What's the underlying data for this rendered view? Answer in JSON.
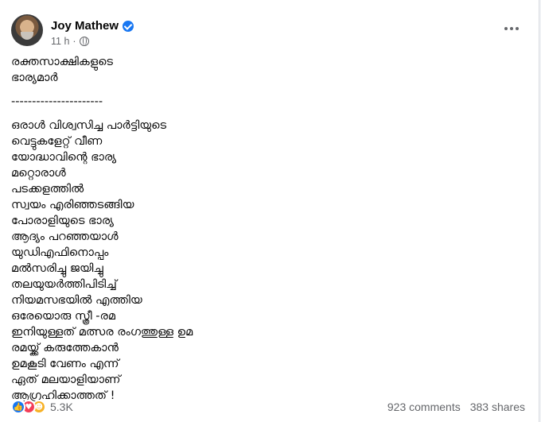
{
  "post": {
    "author": "Joy Mathew",
    "time": "11 h",
    "separator": "·",
    "lines": [
      "രക്തസാക്ഷികളുടെ",
      "ഭാര്യമാർ",
      "----------------------",
      "ഒരാൾ വിശ്വസിച്ച പാർട്ടിയുടെ",
      "വെട്ടുകളേറ്റ് വീണ",
      "യോദ്ധാവിന്റെ ഭാര്യ",
      "മറ്റൊരാൾ",
      "പടക്കളത്തിൽ",
      "സ്വയം എരിഞ്ഞടങ്ങിയ",
      "പോരാളിയുടെ ഭാര്യ",
      "ആദ്യം പറഞ്ഞയാൾ",
      "യുഡിഎഫിനൊപ്പം",
      "മൽസരിച്ചു ജയിച്ചു",
      "തലയുയർത്തിപിടിച്ച്",
      "നിയമസഭയിൽ എത്തിയ",
      "ഒരേയൊരു സ്ത്രീ -രമ",
      "ഇനിയുള്ളത് മത്സര രംഗത്തുള്ള ഉമ",
      "രമയ്ക്ക് കരുത്തേകാൻ",
      "ഉമകൂടി വേണം എന്ന്",
      "ഏത് മലയാളിയാണ്",
      "ആഗ്രഹിക്കാത്തത് !"
    ]
  },
  "icons": {
    "verified": "verified-badge-icon",
    "privacy": "globe-icon",
    "more": "more-options-icon",
    "reactions": [
      "like-icon",
      "love-icon",
      "haha-icon"
    ]
  },
  "footer": {
    "reaction_count": "5.3K",
    "comments": "923 comments",
    "shares": "383 shares"
  },
  "colors": {
    "accent": "#1877f2",
    "love": "#f33e58",
    "haha": "#f7b125",
    "secondary_text": "#65676b"
  }
}
